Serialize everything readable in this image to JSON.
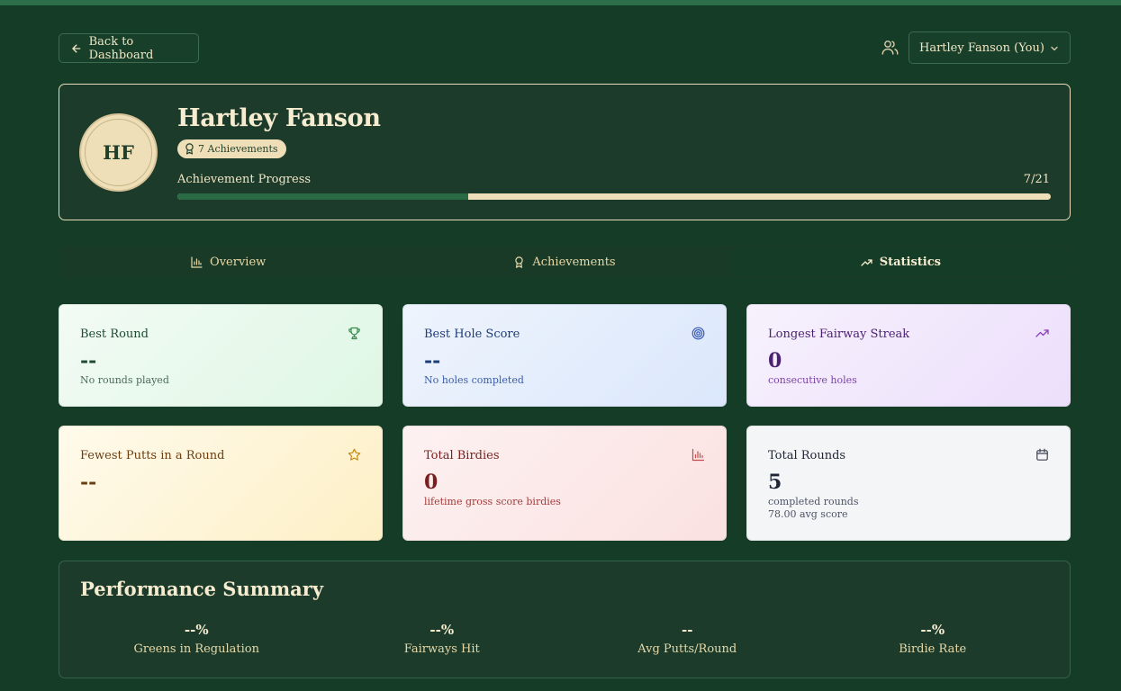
{
  "header": {
    "back_label": "Back to Dashboard",
    "selected_player": "Hartley Fanson (You)"
  },
  "profile": {
    "initials": "HF",
    "name": "Hartley Fanson",
    "achievements_badge": "7 Achievements",
    "progress_label": "Achievement Progress",
    "progress_count": "7/21",
    "progress_fraction": 0.333
  },
  "tabs": [
    {
      "label": "Overview",
      "icon": "bar-chart-icon",
      "active": false
    },
    {
      "label": "Achievements",
      "icon": "award-icon",
      "active": false
    },
    {
      "label": "Statistics",
      "icon": "trending-up-icon",
      "active": true
    }
  ],
  "stats": [
    {
      "title": "Best Round",
      "value": "--",
      "sub": "No rounds played",
      "icon": "trophy-icon",
      "accent": "#3a8a4f"
    },
    {
      "title": "Best Hole Score",
      "value": "--",
      "sub": "No holes completed",
      "icon": "target-icon",
      "accent": "#3558b7"
    },
    {
      "title": "Longest Fairway Streak",
      "value": "0",
      "sub": "consecutive holes",
      "icon": "trending-up-icon",
      "accent": "#8b3fb9"
    },
    {
      "title": "Fewest Putts in a Round",
      "value": "--",
      "sub": "",
      "icon": "star-icon",
      "accent": "#c48a16"
    },
    {
      "title": "Total Birdies",
      "value": "0",
      "sub": "lifetime gross score birdies",
      "icon": "bar-chart-icon",
      "accent": "#c94a4a"
    },
    {
      "title": "Total Rounds",
      "value": "5",
      "sub": "completed rounds",
      "sub2": "78.00 avg score",
      "icon": "calendar-icon",
      "accent": "#3b4250"
    }
  ],
  "performance": {
    "title": "Performance Summary",
    "items": [
      {
        "value": "--%",
        "label": "Greens in Regulation"
      },
      {
        "value": "--%",
        "label": "Fairways Hit"
      },
      {
        "value": "--",
        "label": "Avg Putts/Round"
      },
      {
        "value": "--%",
        "label": "Birdie Rate"
      }
    ]
  },
  "colors": {
    "background": "#143c26",
    "cream": "#efdfb8",
    "progress_fill": "#2a6b45"
  }
}
